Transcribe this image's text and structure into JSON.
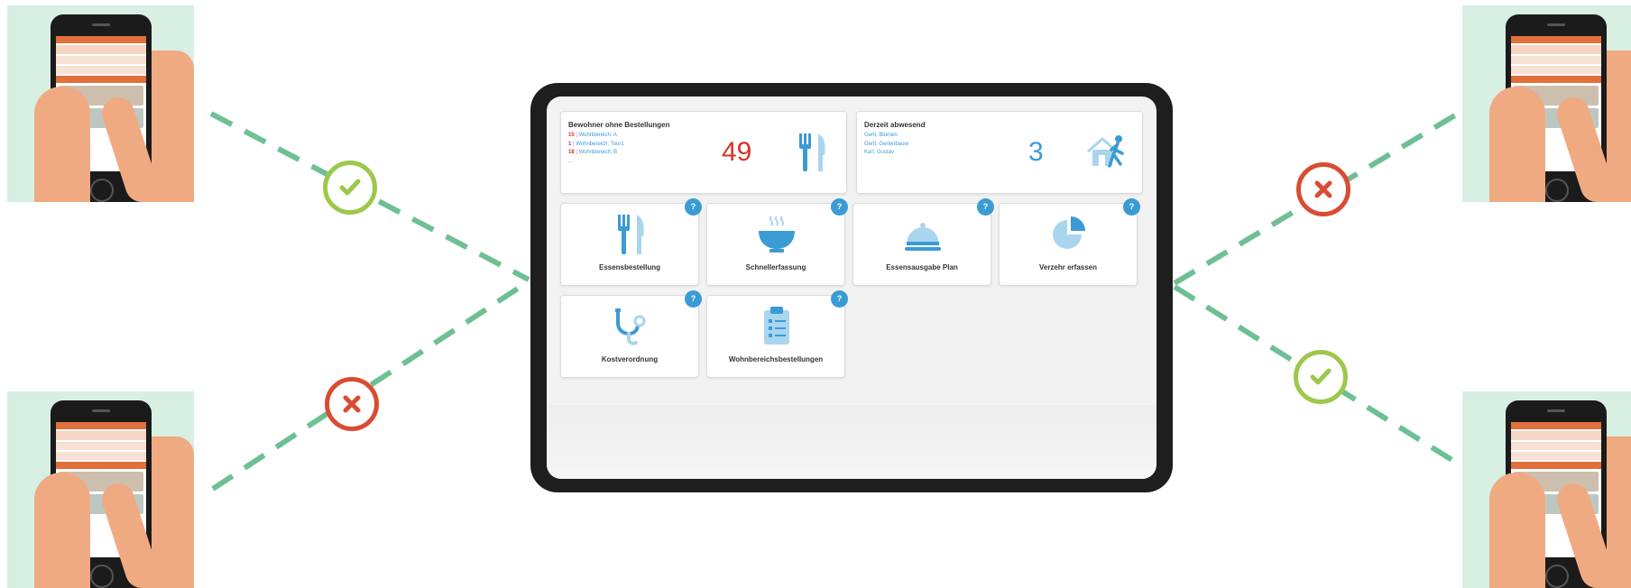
{
  "colors": {
    "accent_blue": "#3a9bd5",
    "light_blue": "#a9d5ef",
    "alert_red": "#d9302a",
    "ok_green": "#9dc84b",
    "error_red": "#d94c33",
    "line_green": "#6fbf95"
  },
  "dashboard": {
    "residents_card": {
      "title": "Bewohner ohne Bestellungen",
      "entries": [
        {
          "count": "15",
          "area": "Wohnbereich: A"
        },
        {
          "count": "1",
          "area": "Wohnbereich: Tour1"
        },
        {
          "count": "18",
          "area": "Wohnbereich: B"
        }
      ],
      "more": "...",
      "total": "49",
      "icon": "cutlery-icon"
    },
    "absent_card": {
      "title": "Derzeit abwesend",
      "names": [
        "Gertl, Blumen",
        "Gertl, Gerlenbauer",
        "Karl, Gustav"
      ],
      "total": "3",
      "icon": "house-walking-person-icon"
    },
    "tiles": [
      {
        "label": "Essensbestellung",
        "icon": "cutlery-icon",
        "help": "?"
      },
      {
        "label": "Schnellerfassung",
        "icon": "bowl-icon",
        "help": "?"
      },
      {
        "label": "Essensausgabe Plan",
        "icon": "cloche-icon",
        "help": "?"
      },
      {
        "label": "Verzehr erfassen",
        "icon": "pie-chart-icon",
        "help": "?"
      },
      {
        "label": "Kostverordnung",
        "icon": "stethoscope-icon",
        "help": "?"
      },
      {
        "label": "Wohnbereichsbestellungen",
        "icon": "clipboard-icon",
        "help": "?"
      }
    ]
  },
  "connections": [
    {
      "position": "top-left",
      "status": "ok",
      "icon": "checkmark-icon"
    },
    {
      "position": "bottom-left",
      "status": "error",
      "icon": "cross-icon"
    },
    {
      "position": "top-right",
      "status": "error",
      "icon": "cross-icon"
    },
    {
      "position": "bottom-right",
      "status": "ok",
      "icon": "checkmark-icon"
    }
  ]
}
